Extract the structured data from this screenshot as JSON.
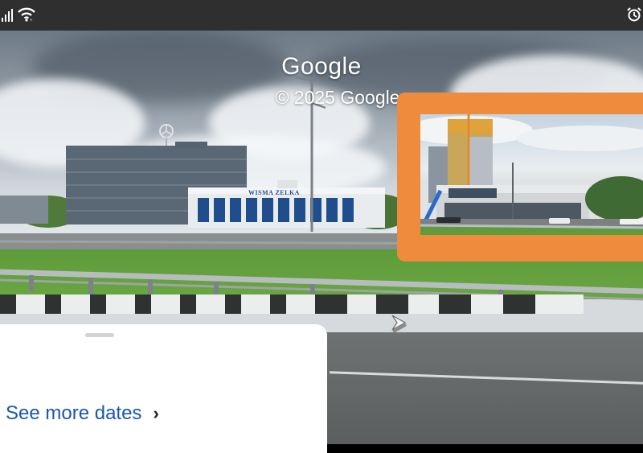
{
  "status_bar": {
    "icons": [
      "signal-icon",
      "wifi-icon",
      "alarm-icon"
    ]
  },
  "street_view": {
    "watermark_title": "Google",
    "watermark_copyright": "© 2025 Google",
    "building_sign": "WISMA ZELKA",
    "inset_frame_color": "#ee8b3c"
  },
  "bottom_sheet": {
    "see_more_label": "See more dates",
    "link_color": "#1a56b0"
  }
}
